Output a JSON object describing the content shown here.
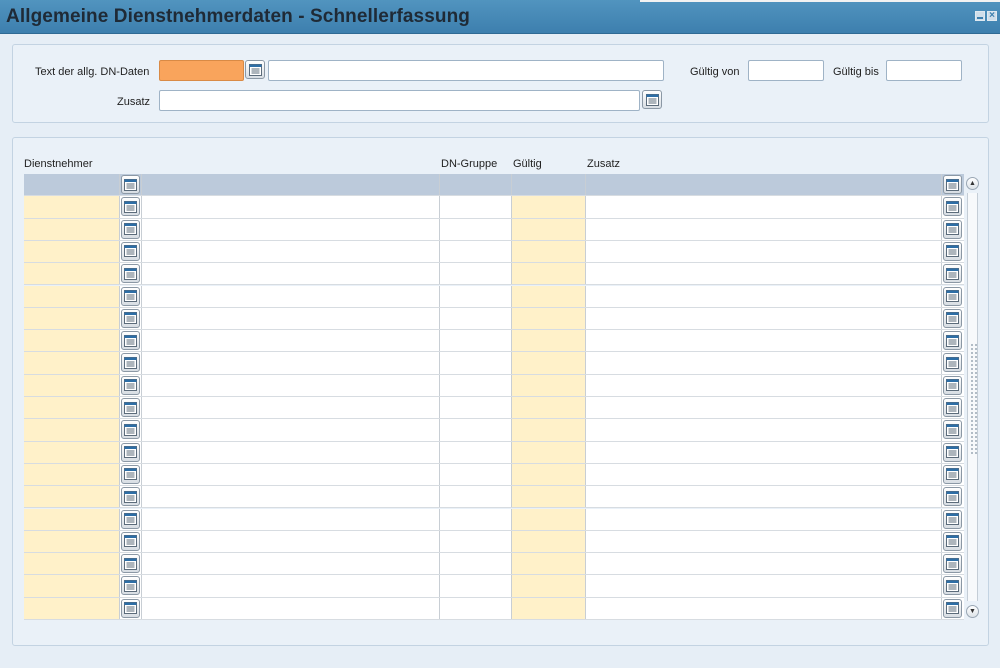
{
  "window": {
    "title": "Allgemeine Dienstnehmerdaten - Schnellerfassung",
    "minimize_icon": "minimize-icon",
    "close_icon": "close-icon",
    "close_glyph": "×"
  },
  "form": {
    "text_label": "Text der allg. DN-Daten",
    "text_code_value": "",
    "text_value": "",
    "valid_from_label": "Gültig von",
    "valid_from_value": "",
    "valid_to_label": "Gültig bis",
    "valid_to_value": "",
    "zusatz_label": "Zusatz",
    "zusatz_value": ""
  },
  "grid": {
    "columns": {
      "dienstnehmer": "Dienstnehmer",
      "dn_gruppe": "DN-Gruppe",
      "gueltig": "Gültig",
      "zusatz": "Zusatz"
    },
    "row_count": 20,
    "selected_row": 0,
    "rows": []
  },
  "icons": {
    "lookup": "list-lookup-icon",
    "scroll_up": "scroll-up-icon",
    "scroll_down": "scroll-down-icon"
  },
  "colors": {
    "titlebar": "#3d7fae",
    "required_field": "#f9a45c",
    "key_column": "#fff1c9",
    "selected_row": "#bccadb"
  }
}
